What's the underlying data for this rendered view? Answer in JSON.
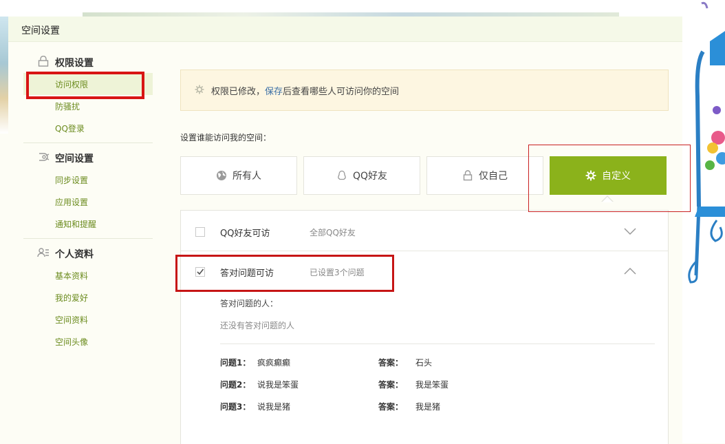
{
  "panel": {
    "title": "空间设置"
  },
  "sidebar": {
    "groups": [
      {
        "title": "权限设置",
        "icon": "lock-icon",
        "items": [
          "访问权限",
          "防骚扰",
          "QQ登录"
        ]
      },
      {
        "title": "空间设置",
        "icon": "space-settings-icon",
        "items": [
          "同步设置",
          "应用设置",
          "通知和提醒"
        ]
      },
      {
        "title": "个人资料",
        "icon": "profile-card-icon",
        "items": [
          "基本资料",
          "我的爱好",
          "空间资料",
          "空间头像"
        ]
      }
    ],
    "active_item": "访问权限"
  },
  "notice": {
    "icon": "gear-icon",
    "before": "权限已修改，",
    "link": "保存",
    "after": "后查看哪些人可访问你的空间"
  },
  "access": {
    "prompt": "设置谁能访问我的空间：",
    "options": [
      {
        "label": "所有人",
        "icon": "globe-icon"
      },
      {
        "label": "QQ好友",
        "icon": "qq-penguin-icon"
      },
      {
        "label": "仅自己",
        "icon": "lock-icon"
      },
      {
        "label": "自定义",
        "icon": "gear-icon"
      }
    ],
    "selected": "自定义"
  },
  "rules": [
    {
      "title": "QQ好友可访",
      "desc": "全部QQ好友",
      "checked": false,
      "expanded": false
    },
    {
      "title": "答对问题可访",
      "desc": "已设置3个问题",
      "checked": true,
      "expanded": true
    }
  ],
  "answered": {
    "label": "答对问题的人：",
    "empty": "还没有答对问题的人"
  },
  "questions": [
    {
      "q_label": "问题1：",
      "q": "疯疯癫癫",
      "a_label": "答案：",
      "a": "石头"
    },
    {
      "q_label": "问题2：",
      "q": "说我是笨蛋",
      "a_label": "答案：",
      "a": "我是笨蛋"
    },
    {
      "q_label": "问题3：",
      "q": "说我是猪",
      "a_label": "答案：",
      "a": "我是猪"
    }
  ],
  "colors": {
    "accent": "#8bb21b",
    "link": "#6c8c1f",
    "highlight": "#d81414",
    "notice_bg": "#fdf6e1"
  }
}
